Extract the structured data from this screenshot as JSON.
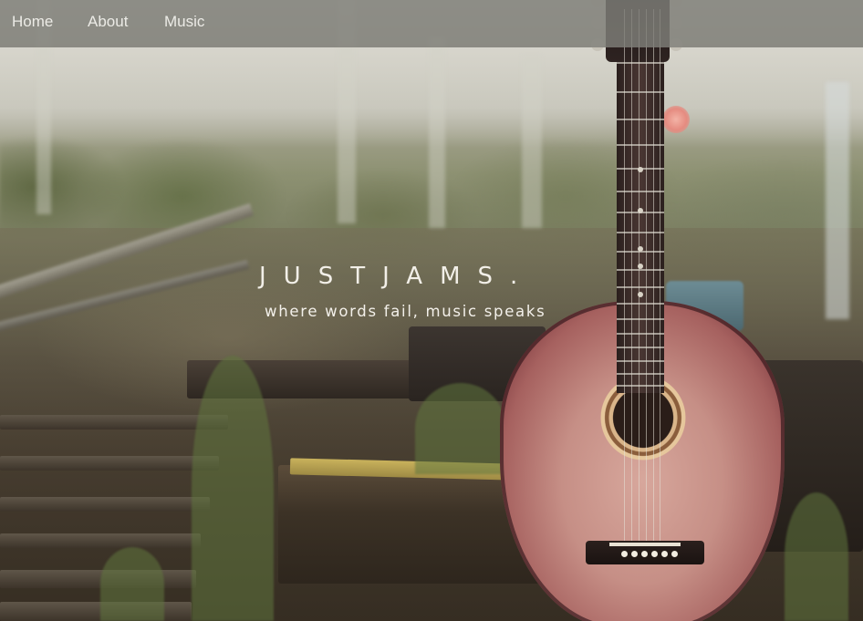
{
  "nav": {
    "items": [
      {
        "label": "Home"
      },
      {
        "label": "About"
      },
      {
        "label": "Music"
      }
    ]
  },
  "hero": {
    "title": "JUSTJAMS",
    "title_dot": ".",
    "tagline": "where words fail, music speaks",
    "background_image": "acoustic guitar leaning on railway sleepers"
  },
  "colors": {
    "navbar_bg": "#80807A",
    "nav_text": "#ECEBE6",
    "title_text": "#F2EFE8"
  }
}
